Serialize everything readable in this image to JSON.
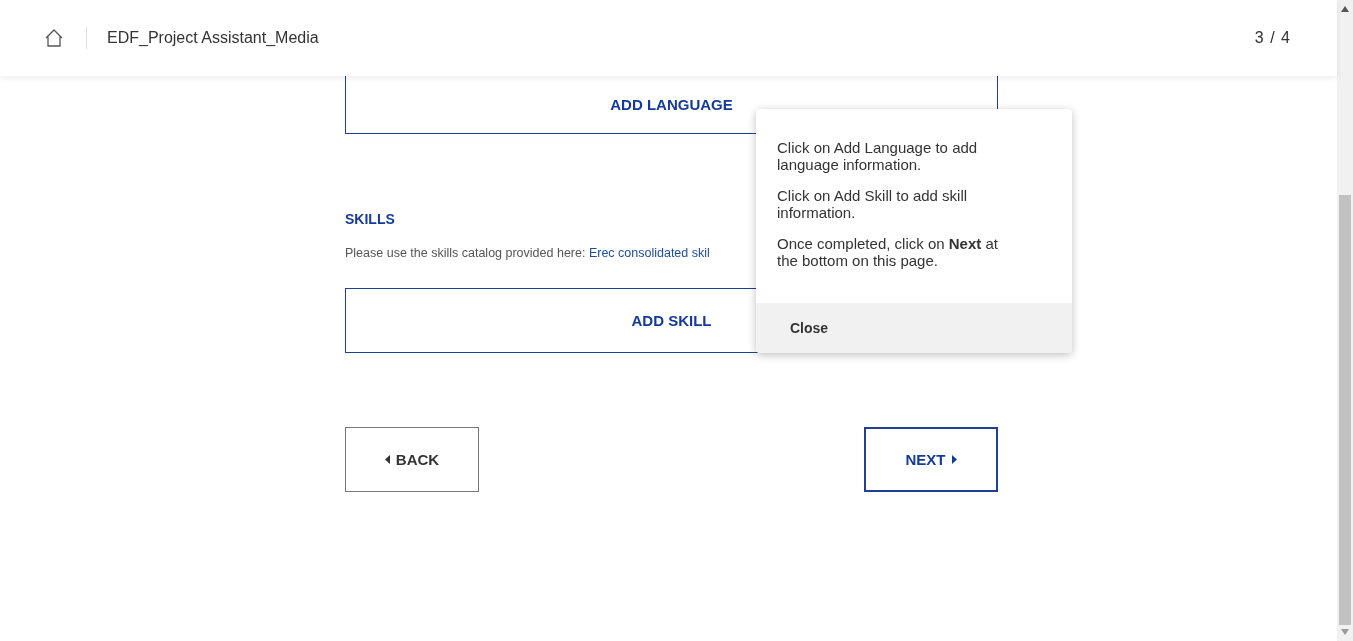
{
  "header": {
    "title": "EDF_Project Assistant_Media",
    "page_counter": "3 / 4"
  },
  "languages": {
    "add_button": "ADD LANGUAGE"
  },
  "skills": {
    "heading": "SKILLS",
    "hint": "Please use the skills catalog provided here: ",
    "link": "Erec consolidated skil",
    "add_button": "ADD SKILL"
  },
  "nav": {
    "back": "BACK",
    "next": "NEXT"
  },
  "popover": {
    "paragraphs": [
      "Click on Add Language to add language information.",
      "Click on Add Skill to add skill information.",
      "Once completed, click on **Next** at the bottom on this page."
    ],
    "close": "Close"
  }
}
